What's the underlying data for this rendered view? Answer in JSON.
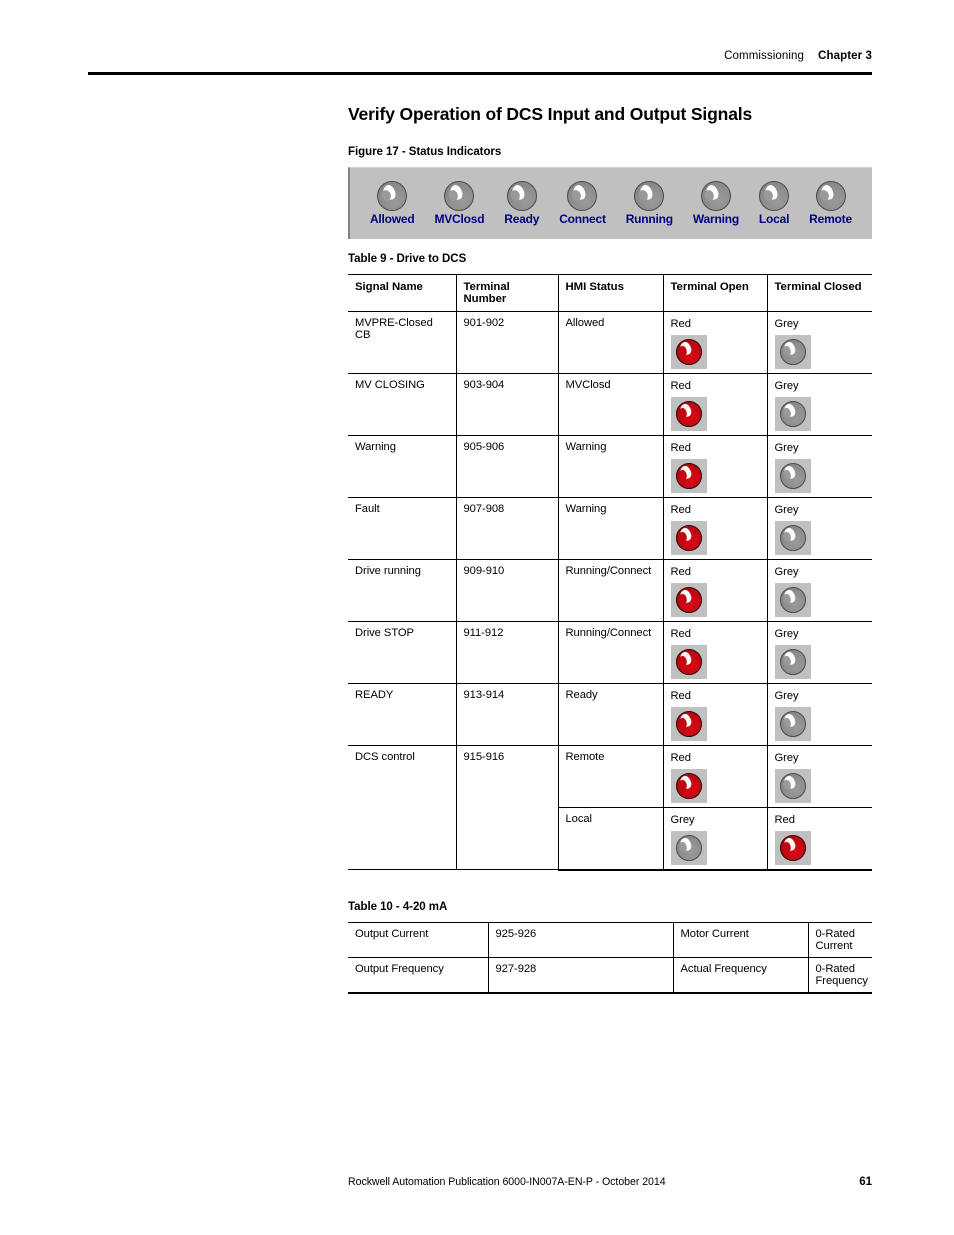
{
  "header": {
    "section": "Commissioning",
    "chapter": "Chapter 3"
  },
  "section_title": "Verify Operation of DCS Input and Output Signals",
  "figure": {
    "caption": "Figure 17 - Status Indicators",
    "panel_bg": "#c0c0c0",
    "label_color": "#000080",
    "indicators": [
      {
        "label": "Allowed",
        "state": "grey"
      },
      {
        "label": "MVClosd",
        "state": "grey"
      },
      {
        "label": "Ready",
        "state": "grey"
      },
      {
        "label": "Connect",
        "state": "grey"
      },
      {
        "label": "Running",
        "state": "grey"
      },
      {
        "label": "Warning",
        "state": "grey"
      },
      {
        "label": "Local",
        "state": "grey"
      },
      {
        "label": "Remote",
        "state": "grey"
      }
    ]
  },
  "table9": {
    "caption": "Table 9 - Drive to DCS",
    "columns": [
      "Signal Name",
      "Terminal Number",
      "HMI Status",
      "Terminal Open",
      "Terminal Closed"
    ],
    "rows": [
      {
        "signal_name": "MVPRE-Closed CB",
        "terminal_number": "901-902",
        "hmi_status": "Allowed",
        "terminal_open": "Red",
        "terminal_open_state": "red",
        "terminal_closed": "Grey",
        "terminal_closed_state": "grey"
      },
      {
        "signal_name": "MV CLOSING",
        "terminal_number": "903-904",
        "hmi_status": "MVClosd",
        "terminal_open": "Red",
        "terminal_open_state": "red",
        "terminal_closed": "Grey",
        "terminal_closed_state": "grey"
      },
      {
        "signal_name": "Warning",
        "terminal_number": "905-906",
        "hmi_status": "Warning",
        "terminal_open": "Red",
        "terminal_open_state": "red",
        "terminal_closed": "Grey",
        "terminal_closed_state": "grey"
      },
      {
        "signal_name": "Fault",
        "terminal_number": "907-908",
        "hmi_status": "Warning",
        "terminal_open": "Red",
        "terminal_open_state": "red",
        "terminal_closed": "Grey",
        "terminal_closed_state": "grey"
      },
      {
        "signal_name": "Drive running",
        "terminal_number": "909-910",
        "hmi_status": "Running/Connect",
        "terminal_open": "Red",
        "terminal_open_state": "red",
        "terminal_closed": "Grey",
        "terminal_closed_state": "grey"
      },
      {
        "signal_name": "Drive STOP",
        "terminal_number": "911-912",
        "hmi_status": "Running/Connect",
        "terminal_open": "Red",
        "terminal_open_state": "red",
        "terminal_closed": "Grey",
        "terminal_closed_state": "grey"
      },
      {
        "signal_name": "READY",
        "terminal_number": "913-914",
        "hmi_status": "Ready",
        "terminal_open": "Red",
        "terminal_open_state": "red",
        "terminal_closed": "Grey",
        "terminal_closed_state": "grey"
      },
      {
        "signal_name": "DCS control",
        "terminal_number": "915-916",
        "hmi_status": "Remote",
        "terminal_open": "Red",
        "terminal_open_state": "red",
        "terminal_closed": "Grey",
        "terminal_closed_state": "grey"
      },
      {
        "signal_name": "",
        "terminal_number": "",
        "hmi_status": "Local",
        "terminal_open": "Grey",
        "terminal_open_state": "grey",
        "terminal_closed": "Red",
        "terminal_closed_state": "red"
      }
    ]
  },
  "table10": {
    "caption": "Table 10 - 4-20 mA",
    "rows": [
      {
        "signal_name": "Output Current",
        "terminal_number": "925-926",
        "hmi_status": "Motor Current",
        "range": "0-Rated Current"
      },
      {
        "signal_name": "Output Frequency",
        "terminal_number": "927-928",
        "hmi_status": "Actual Frequency",
        "range": "0-Rated Frequency"
      }
    ]
  },
  "footer": {
    "publication": "Rockwell Automation Publication 6000-IN007A-EN-P - October 2014",
    "page_number": "61"
  }
}
